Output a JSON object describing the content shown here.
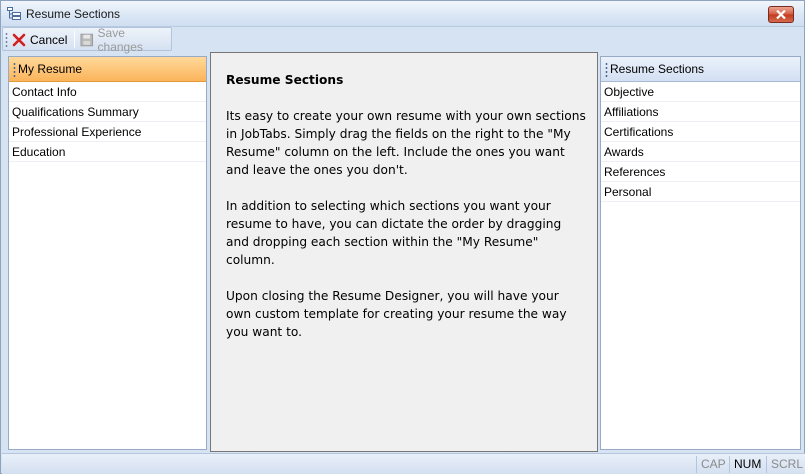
{
  "window": {
    "title": "Resume Sections"
  },
  "toolbar": {
    "cancel_label": "Cancel",
    "save_label": "Save changes"
  },
  "left_panel": {
    "header": "My Resume",
    "items": [
      "Contact Info",
      "Qualifications Summary",
      "Professional Experience",
      "Education"
    ]
  },
  "center": {
    "heading": "Resume Sections",
    "paragraphs": [
      "Its easy to create your own resume with your own sections in JobTabs.  Simply drag the fields on the right to the \"My Resume\" column on the left.  Include the ones you want and leave the ones you don't.",
      "In addition to selecting which sections you want your resume to have, you can dictate the order by dragging and dropping each section within the \"My Resume\" column.",
      "Upon closing the Resume Designer, you will have your own custom template for creating your resume the way you want to."
    ]
  },
  "right_panel": {
    "header": "Resume Sections",
    "items": [
      "Objective",
      "Affiliations",
      "Certifications",
      "Awards",
      "References",
      "Personal"
    ]
  },
  "status": {
    "cap": "CAP",
    "num": "NUM",
    "scrl": "SCRL"
  },
  "icons": {
    "window": "app-window-icon",
    "close": "close-icon",
    "cancel": "red-x-icon",
    "save": "floppy-disk-icon"
  },
  "colors": {
    "my_resume_header": "#fbb45a",
    "sections_header": "#d3e0f2",
    "cancel_icon": "#d21e1e"
  }
}
